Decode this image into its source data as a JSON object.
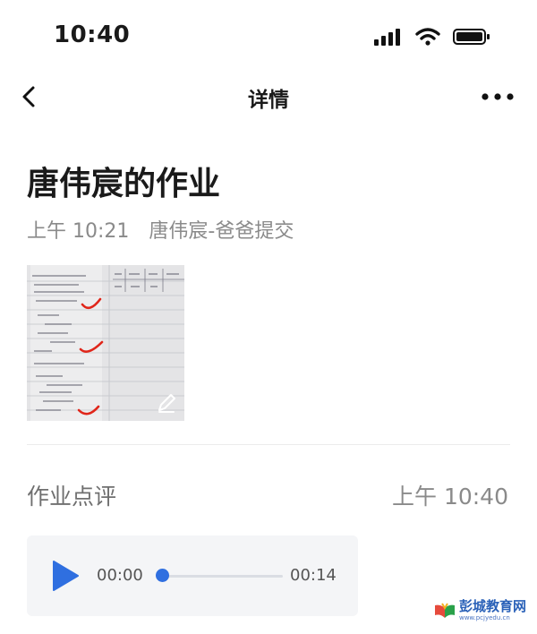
{
  "status_bar": {
    "time": "10:40"
  },
  "nav": {
    "title": "详情"
  },
  "homework": {
    "title": "唐伟宸的作业",
    "submit_time": "上午 10:21",
    "submitter": "唐伟宸-爸爸提交"
  },
  "review": {
    "label": "作业点评",
    "time": "上午 10:40",
    "audio": {
      "current": "00:00",
      "duration": "00:14",
      "progress": 0
    }
  },
  "watermark": {
    "name": "彭城教育网",
    "url": "www.pcjyedu.cn"
  },
  "colors": {
    "accent": "#2f6fe0",
    "check_mark": "#e0261a"
  }
}
